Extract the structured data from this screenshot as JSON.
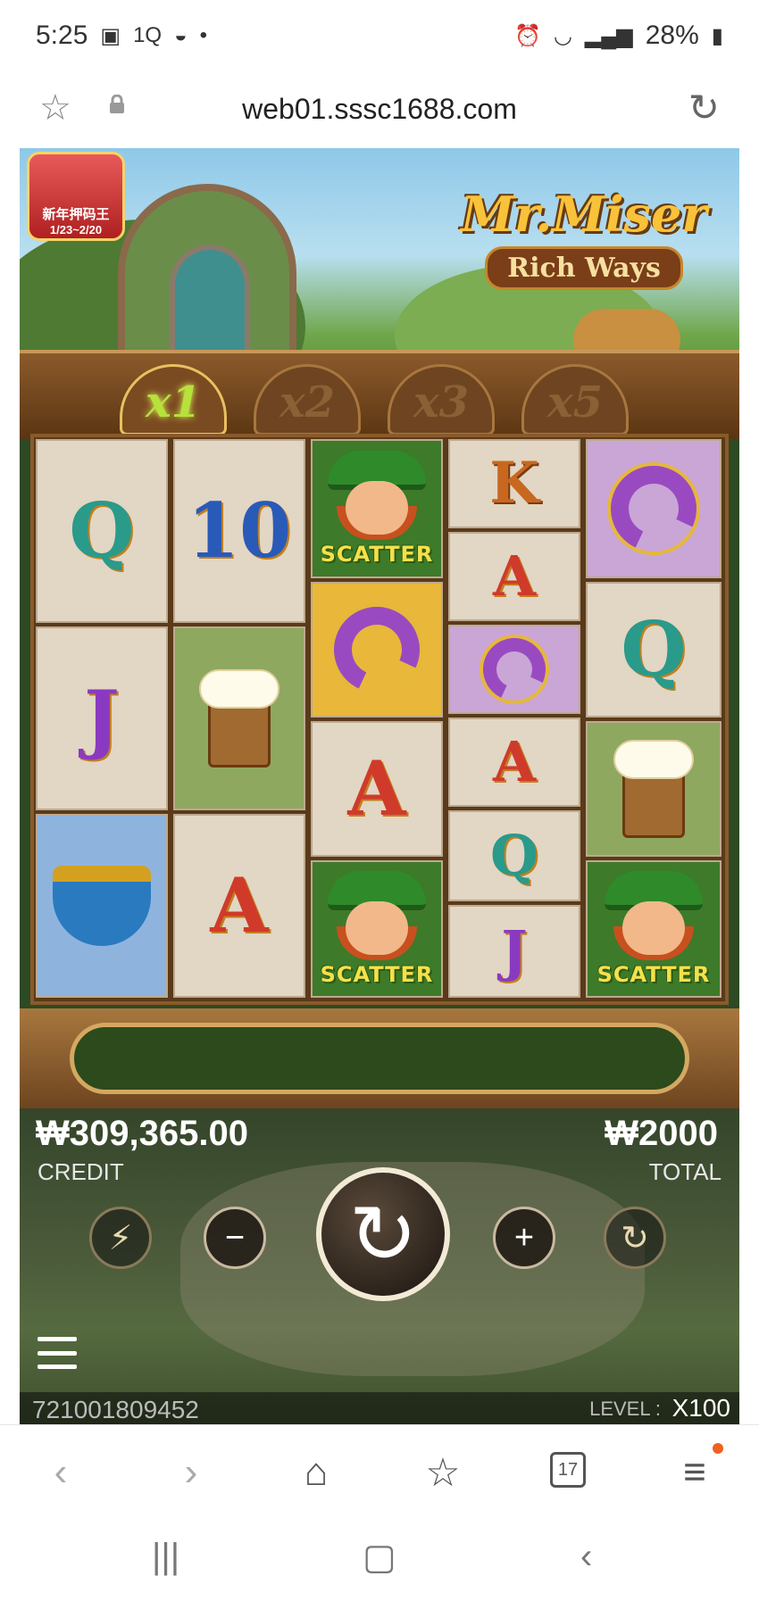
{
  "status_bar": {
    "time": "5:25",
    "battery": "28%"
  },
  "url_bar": {
    "url": "web01.sssc1688.com"
  },
  "game": {
    "event_badge": {
      "title": "新年押码王",
      "dates": "1/23~2/20"
    },
    "logo": {
      "title": "Mr.Miser",
      "subtitle": "Rich Ways"
    },
    "multipliers": [
      "x1",
      "x2",
      "x3",
      "x5"
    ],
    "active_multiplier": "x1",
    "reels": {
      "col1": [
        "Q",
        "J",
        "pipe"
      ],
      "col2": [
        "10",
        "beer-mug",
        "A"
      ],
      "col3": [
        "SCATTER",
        "horseshoe",
        "A",
        "SCATTER"
      ],
      "col4": [
        "K",
        "A",
        "horseshoe",
        "A",
        "Q",
        "J"
      ],
      "col5": [
        "horseshoe",
        "Q",
        "beer-mug",
        "SCATTER"
      ],
      "scatter_label": "SCATTER"
    },
    "credit": {
      "value": "₩309,365.00",
      "label": "CREDIT"
    },
    "total": {
      "value": "₩2000",
      "label": "TOTAL"
    },
    "footer": {
      "session_id": "721001809452",
      "level_label": "LEVEL :",
      "level_value": "X100"
    },
    "buttons": {
      "turbo_icon": "⚡",
      "minus_icon": "−",
      "spin_icon": "↻",
      "plus_icon": "+",
      "autoplay_icon": "↻"
    }
  },
  "browser_nav": {
    "tab_count": "17"
  },
  "colors": {
    "scatter_label": "#f6e04a",
    "active_multiplier": "#b6e23a",
    "message_panel": "#2c4a1c"
  }
}
